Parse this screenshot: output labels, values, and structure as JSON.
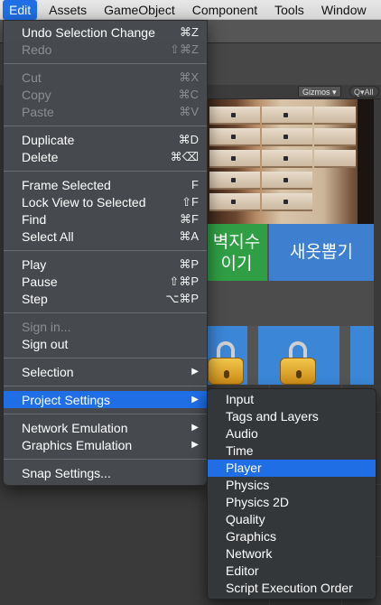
{
  "menubar": {
    "items": [
      "Edit",
      "Assets",
      "GameObject",
      "Component",
      "Tools",
      "Window"
    ],
    "active_index": 0
  },
  "scene": {
    "gizmos_label": "Gizmos",
    "gizmos_caret": "▾",
    "search_label": "Q▾All",
    "button_green_line1": "벽지수",
    "button_green_line2": "이기",
    "button_blue_label": "새옷뽑기"
  },
  "edit_menu": {
    "items": [
      {
        "label": "Undo Selection Change",
        "shortcut": "⌘Z",
        "disabled": false
      },
      {
        "label": "Redo",
        "shortcut": "⇧⌘Z",
        "disabled": true
      },
      {
        "label": "Cut",
        "shortcut": "⌘X",
        "disabled": true
      },
      {
        "label": "Copy",
        "shortcut": "⌘C",
        "disabled": true
      },
      {
        "label": "Paste",
        "shortcut": "⌘V",
        "disabled": true
      },
      {
        "label": "Duplicate",
        "shortcut": "⌘D",
        "disabled": false
      },
      {
        "label": "Delete",
        "shortcut": "⌘⌫",
        "disabled": false
      },
      {
        "label": "Frame Selected",
        "shortcut": "F",
        "disabled": false
      },
      {
        "label": "Lock View to Selected",
        "shortcut": "⇧F",
        "disabled": false
      },
      {
        "label": "Find",
        "shortcut": "⌘F",
        "disabled": false
      },
      {
        "label": "Select All",
        "shortcut": "⌘A",
        "disabled": false
      },
      {
        "label": "Play",
        "shortcut": "⌘P",
        "disabled": false
      },
      {
        "label": "Pause",
        "shortcut": "⇧⌘P",
        "disabled": false
      },
      {
        "label": "Step",
        "shortcut": "⌥⌘P",
        "disabled": false
      },
      {
        "label": "Sign in...",
        "shortcut": "",
        "disabled": true
      },
      {
        "label": "Sign out",
        "shortcut": "",
        "disabled": false
      },
      {
        "label": "Selection",
        "shortcut": "▶",
        "disabled": false
      },
      {
        "label": "Project Settings",
        "shortcut": "▶",
        "disabled": false,
        "highlighted": true
      },
      {
        "label": "Network Emulation",
        "shortcut": "▶",
        "disabled": false
      },
      {
        "label": "Graphics Emulation",
        "shortcut": "▶",
        "disabled": false
      },
      {
        "label": "Snap Settings...",
        "shortcut": "",
        "disabled": false
      }
    ]
  },
  "project_settings_submenu": {
    "items": [
      "Input",
      "Tags and Layers",
      "Audio",
      "Time",
      "Player",
      "Physics",
      "Physics 2D",
      "Quality",
      "Graphics",
      "Network",
      "Editor",
      "Script Execution Order"
    ],
    "highlighted_index": 4
  },
  "colors": {
    "highlight": "#1f6ee6",
    "menu_bg": "#464a4e",
    "disabled_text": "#8b8e91",
    "green_button": "#2f9e44",
    "blue_button": "#3f7fd0"
  }
}
